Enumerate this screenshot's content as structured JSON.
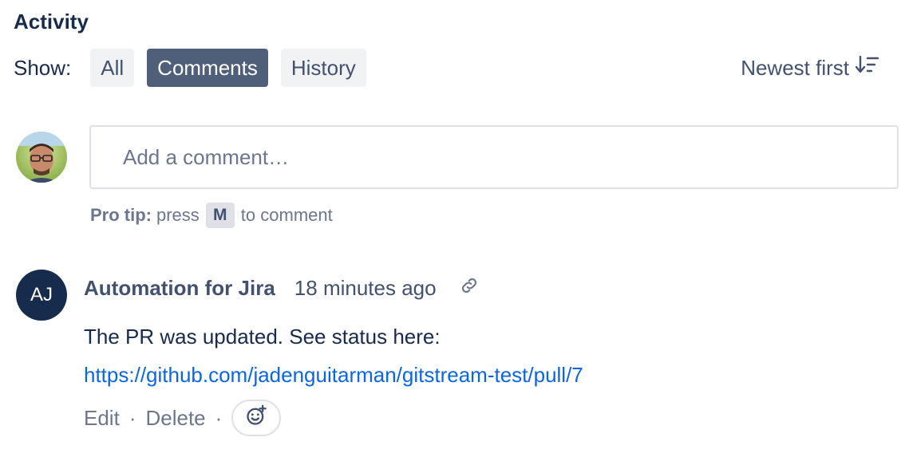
{
  "activity": {
    "title": "Activity"
  },
  "filters": {
    "label": "Show:",
    "options": [
      "All",
      "Comments",
      "History"
    ],
    "active": "Comments"
  },
  "sort": {
    "label": "Newest first",
    "icon": "sort-descending-icon"
  },
  "composer": {
    "placeholder": "Add a comment…",
    "pro_tip_label": "Pro tip:",
    "pro_tip_press": "press",
    "pro_tip_key": "M",
    "pro_tip_suffix": "to comment"
  },
  "comment": {
    "avatar_initials": "AJ",
    "author": "Automation for Jira",
    "time": "18 minutes ago",
    "body": "The PR was updated. See status here:",
    "link": "https://github.com/jadenguitarman/gitstream-test/pull/7",
    "actions": {
      "edit": "Edit",
      "delete": "Delete",
      "separator": "·"
    }
  },
  "colors": {
    "active_filter_bg": "#505f79",
    "inactive_filter_bg": "#f1f2f4",
    "link": "#0c66e4",
    "avatar_bg": "#172b4d"
  }
}
